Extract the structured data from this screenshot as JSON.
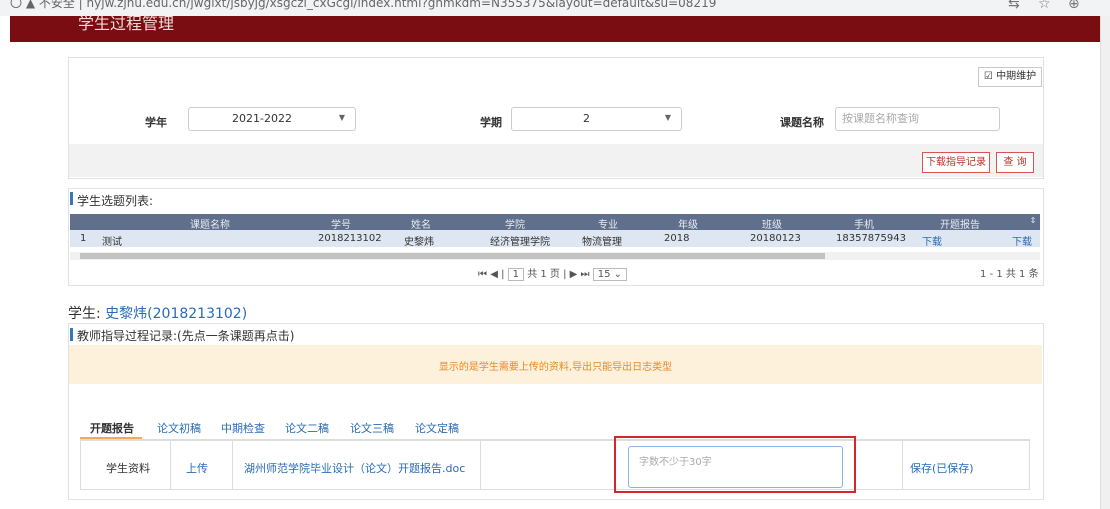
{
  "browser": {
    "url": "〇  ▲ 不安全 | hyjw.zjhu.edu.cn/jwglxt/jsbyjg/xsgczl_cxGcgl/index.html?gnmkdm=N355375&layout=default&su=08219"
  },
  "app": {
    "title": "学生过程管理"
  },
  "query": {
    "midterm_button": "中期维护",
    "year_label": "学年",
    "year_value": "2021-2022",
    "term_label": "学期",
    "term_value": "2",
    "topic_label": "课题名称",
    "topic_placeholder": "按课题名称查询",
    "download_button": "下载指导记录",
    "search_button": "查 询"
  },
  "grid": {
    "title": "学生选题列表:",
    "headers": [
      "课题名称",
      "学号",
      "姓名",
      "学院",
      "专业",
      "年级",
      "班级",
      "手机",
      "开题报告"
    ],
    "rows": [
      {
        "index": "1",
        "cells": [
          "测试",
          "2018213102",
          "史黎炜",
          "经济管理学院",
          "物流管理",
          "2018",
          "20180123",
          "18357875943",
          "下载",
          "下载"
        ]
      }
    ],
    "pager": {
      "page": "1",
      "of_pages": "共 1 页",
      "page_size": "15",
      "summary": "1 - 1  共 1 条"
    }
  },
  "student": {
    "prefix": "学生: ",
    "name": "史黎炜(2018213102)"
  },
  "guidance": {
    "title": "教师指导过程记录:(先点一条课题再点击)",
    "notice": "显示的是学生需要上传的资料,导出只能导出日志类型",
    "tabs": [
      "开题报告",
      "论文初稿",
      "中期检查",
      "论文二稿",
      "论文三稿",
      "论文定稿"
    ],
    "row": {
      "label": "学生资料",
      "upload": "上传",
      "file": "湖州师范学院毕业设计（论文）开题报告.doc",
      "textarea_placeholder": "字数不少于30字",
      "save": "保存(已保存)"
    }
  },
  "colors": {
    "header": "#7a0d12",
    "accent": "#2a6bb7",
    "highlight_box": "#d9232d",
    "notice_bg": "#fdf1dc"
  }
}
